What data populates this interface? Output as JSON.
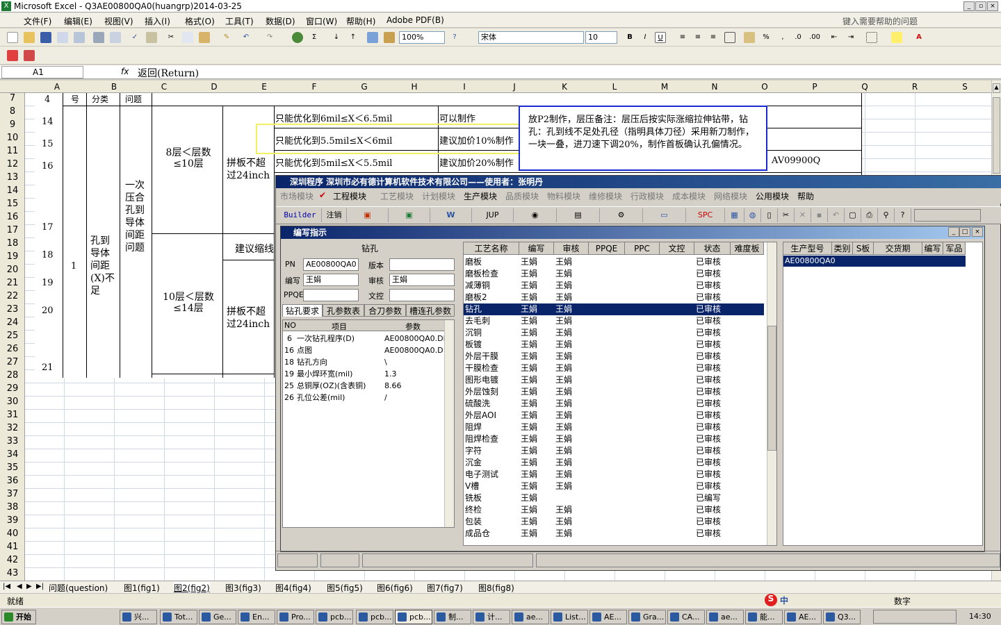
{
  "excel": {
    "title": "Microsoft Excel - Q3AE00800QA0(huangrp)2014-03-25",
    "menu": [
      "文件(F)",
      "编辑(E)",
      "视图(V)",
      "插入(I)",
      "格式(O)",
      "工具(T)",
      "数据(D)",
      "窗口(W)",
      "帮助(H)",
      "Adobe PDF(B)"
    ],
    "help_placeholder": "键入需要帮助的问题",
    "zoom": "100%",
    "font": "宋体",
    "font_size": "10",
    "namebox": "A1",
    "fx": "fx",
    "formula": "返回(Return)",
    "columns": [
      "A",
      "B",
      "C",
      "D",
      "E",
      "F",
      "G",
      "H",
      "I",
      "J",
      "K",
      "L",
      "M",
      "N",
      "O",
      "P",
      "Q",
      "R",
      "S"
    ],
    "rows": [
      "7",
      "8",
      "9",
      "10",
      "11",
      "12",
      "13",
      "14",
      "15",
      "16",
      "17",
      "18",
      "19",
      "20",
      "21",
      "22",
      "23",
      "24",
      "25",
      "26",
      "27",
      "28",
      "29",
      "30",
      "31",
      "32",
      "33",
      "34",
      "35",
      "36",
      "37",
      "38",
      "39",
      "40",
      "41",
      "42",
      "43"
    ],
    "cells": {
      "hdr_a": "号",
      "hdr_b": "分类",
      "hdr_c": "问题",
      "a7": "4",
      "n14": "14",
      "n15": "15",
      "n16": "16",
      "n17": "17",
      "n18": "18",
      "n19": "19",
      "n20": "20",
      "n21": "21",
      "group": "1",
      "category": "孔到导体间距(X)不足",
      "issue": "一次压合孔到导体间距问题",
      "layer1": "8层＜层数≤10层",
      "layer2": "10层＜层数≤14层",
      "panel1": "拼板不超过24inch",
      "panel2": "拼板不超过24inch",
      "opt1": "只能优化到6mil≤X＜6.5mil",
      "opt2": "只能优化到5.5mil≤X＜6mil",
      "opt3": "只能优化到5mil≤X＜5.5mil",
      "res1": "可以制作",
      "res2": "建议加价10%制作",
      "res3": "建议加价20%制作",
      "suggest": "建议缩线",
      "note": "放P2制作，层压备注：层压后按实际涨缩拉伸钻带，钻孔：孔到线不足处孔径（指明具体刀径）采用新刀制作，一块一叠，进刀速下调20%，制作首板确认孔偏情况。",
      "code": "AV09900Q"
    },
    "sheets": [
      "问题(question)",
      "图1(fig1)",
      "图2(fig2)",
      "图3(fig3)",
      "图4(fig4)",
      "图5(fig5)",
      "图6(fig6)",
      "图7(fig7)",
      "图8(fig8)"
    ],
    "status_left": "就绪",
    "status_right": "数字"
  },
  "app": {
    "title": "深圳程序    深圳市必有德计算机软件技术有限公司——使用者：张明丹",
    "menu": [
      "市场模块",
      "工程模块",
      "工艺模块",
      "计划模块",
      "生产模块",
      "品质模块",
      "物料模块",
      "维修模块",
      "行政模块",
      "成本模块",
      "网络模块",
      "公用模块",
      "帮助"
    ],
    "toolbar": [
      "Builder",
      "注销",
      "",
      "",
      "",
      "JUP",
      "",
      "",
      "",
      "",
      "SPC"
    ],
    "sub_title": "编写指示",
    "process_name": "钻孔",
    "pn_label": "PN",
    "pn": "AE00800QA0",
    "version_label": "版本",
    "version": "",
    "writer_label": "编写",
    "writer": "王娟",
    "reviewer_label": "审核",
    "reviewer": "王娟",
    "ppqe_label": "PPQE",
    "ppqe": "",
    "doc_label": "文控",
    "doc": "",
    "tabs": [
      "钻孔要求",
      "孔参数表",
      "合刀参数",
      "槽连孔参数"
    ],
    "params_headers": [
      "NO",
      "项目",
      "参数"
    ],
    "params": [
      {
        "no": "6",
        "item": "一次钻孔程序(D)",
        "val": "AE00800QA0.DRL"
      },
      {
        "no": "16",
        "item": "点图",
        "val": "AE00800QA0.D"
      },
      {
        "no": "18",
        "item": "钻孔方向",
        "val": "\\"
      },
      {
        "no": "19",
        "item": "最小焊环宽(mil)",
        "val": "1.3"
      },
      {
        "no": "25",
        "item": "总铜厚(OZ)(含表铜)",
        "val": "8.66"
      },
      {
        "no": "26",
        "item": "孔位公差(mil)",
        "val": "/"
      }
    ],
    "process_headers": [
      "工艺名称",
      "编写",
      "审核",
      "PPQE",
      "PPC",
      "文控",
      "状态",
      "难度板"
    ],
    "processes": [
      [
        "磨板",
        "王娟",
        "王娟",
        "已审核"
      ],
      [
        "磨板检查",
        "王娟",
        "王娟",
        "已审核"
      ],
      [
        "减薄铜",
        "王娟",
        "王娟",
        "已审核"
      ],
      [
        "磨板2",
        "王娟",
        "王娟",
        "已审核"
      ],
      [
        "钻孔",
        "王娟",
        "王娟",
        "已审核"
      ],
      [
        "去毛刺",
        "王娟",
        "王娟",
        "已审核"
      ],
      [
        "沉铜",
        "王娟",
        "王娟",
        "已审核"
      ],
      [
        "板镀",
        "王娟",
        "王娟",
        "已审核"
      ],
      [
        "外层干膜",
        "王娟",
        "王娟",
        "已审核"
      ],
      [
        "干膜检查",
        "王娟",
        "王娟",
        "已审核"
      ],
      [
        "图形电镀",
        "王娟",
        "王娟",
        "已审核"
      ],
      [
        "外层蚀刻",
        "王娟",
        "王娟",
        "已审核"
      ],
      [
        "硫酸洗",
        "王娟",
        "王娟",
        "已审核"
      ],
      [
        "外层AOI",
        "王娟",
        "王娟",
        "已审核"
      ],
      [
        "阻焊",
        "王娟",
        "王娟",
        "已审核"
      ],
      [
        "阻焊检查",
        "王娟",
        "王娟",
        "已审核"
      ],
      [
        "字符",
        "王娟",
        "王娟",
        "已审核"
      ],
      [
        "沉金",
        "王娟",
        "王娟",
        "已审核"
      ],
      [
        "电子测试",
        "王娟",
        "王娟",
        "已审核"
      ],
      [
        "V槽",
        "王娟",
        "王娟",
        "已审核"
      ],
      [
        "铣板",
        "王娟",
        "",
        "已编写"
      ],
      [
        "终检",
        "王娟",
        "王娟",
        "已审核"
      ],
      [
        "包装",
        "王娟",
        "王娟",
        "已审核"
      ],
      [
        "成品仓",
        "王娟",
        "王娟",
        "已审核"
      ]
    ],
    "order_headers": [
      "生产型号",
      "类别",
      "S板",
      "交货期",
      "编写",
      "军品"
    ],
    "order_row": "AE00800QA0"
  },
  "taskbar": {
    "start": "开始",
    "items": [
      "兴...",
      "Tot...",
      "Ge...",
      "En...",
      "Pro...",
      "pcb...",
      "pcb...",
      "pcb...",
      "制...",
      "计...",
      "ae...",
      "List...",
      "AE...",
      "Gra...",
      "CA...",
      "ae...",
      "能...",
      "AE...",
      "Q3..."
    ],
    "ime": "中",
    "clock": "14:30"
  }
}
